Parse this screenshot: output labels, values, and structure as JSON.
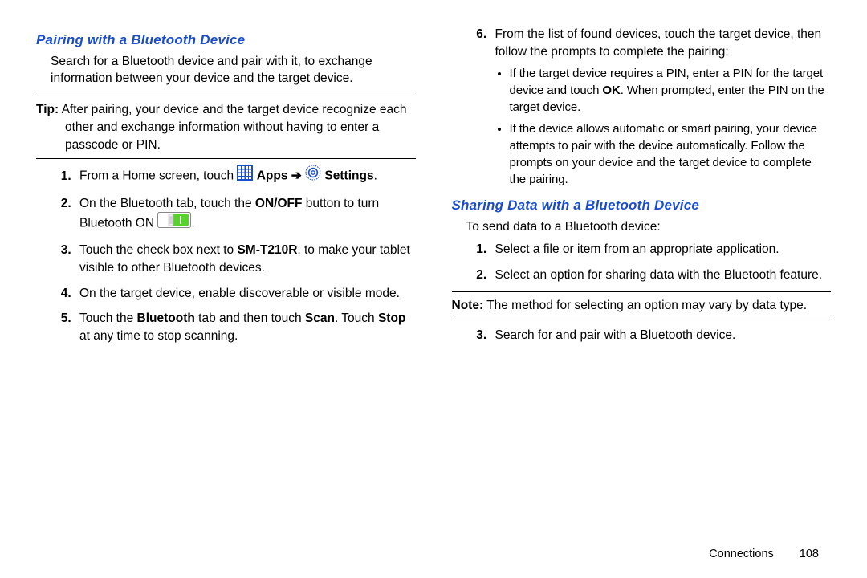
{
  "left": {
    "heading1": "Pairing with a Bluetooth Device",
    "intro": "Search for a Bluetooth device and pair with it, to exchange information between your device and the target device.",
    "tip_label": "Tip:",
    "tip_text": " After pairing, your device and the target device recognize each other and exchange information without having to enter a passcode or PIN.",
    "step1_a": "From a Home screen, touch ",
    "step1_apps": " Apps ",
    "step1_arrow": "➔",
    "step1_settings": " Settings",
    "step1_end": ".",
    "step2_a": "On the Bluetooth tab, touch the ",
    "step2_b": "ON/OFF",
    "step2_c": " button to turn Bluetooth ON ",
    "step2_d": ".",
    "step3_a": "Touch the check box next to ",
    "step3_b": "SM-T210R",
    "step3_c": ", to make your tablet visible to other Bluetooth devices.",
    "step4": "On the target device, enable discoverable or visible mode.",
    "step5_a": "Touch the ",
    "step5_b": "Bluetooth",
    "step5_c": " tab and then touch ",
    "step5_d": "Scan",
    "step5_e": ". Touch ",
    "step5_f": "Stop",
    "step5_g": " at any time to stop scanning."
  },
  "right": {
    "step6": "From the list of found devices, touch the target device, then follow the prompts to complete the pairing:",
    "bullet1_a": "If the target device requires a PIN, enter a PIN for the target device and touch ",
    "bullet1_b": "OK",
    "bullet1_c": ". When prompted, enter the PIN on the target device.",
    "bullet2": "If the device allows automatic or smart pairing, your device attempts to pair with the device automatically. Follow the prompts on your device and the target device to complete the pairing.",
    "heading2": "Sharing Data with a Bluetooth Device",
    "intro2": "To send data to a Bluetooth device:",
    "s1": "Select a file or item from an appropriate application.",
    "s2": "Select an option for sharing data with the Bluetooth feature.",
    "note_label": "Note:",
    "note_text": " The method for selecting an option may vary by data type.",
    "s3": "Search for and pair with a Bluetooth device."
  },
  "footer": {
    "section": "Connections",
    "page": "108"
  }
}
